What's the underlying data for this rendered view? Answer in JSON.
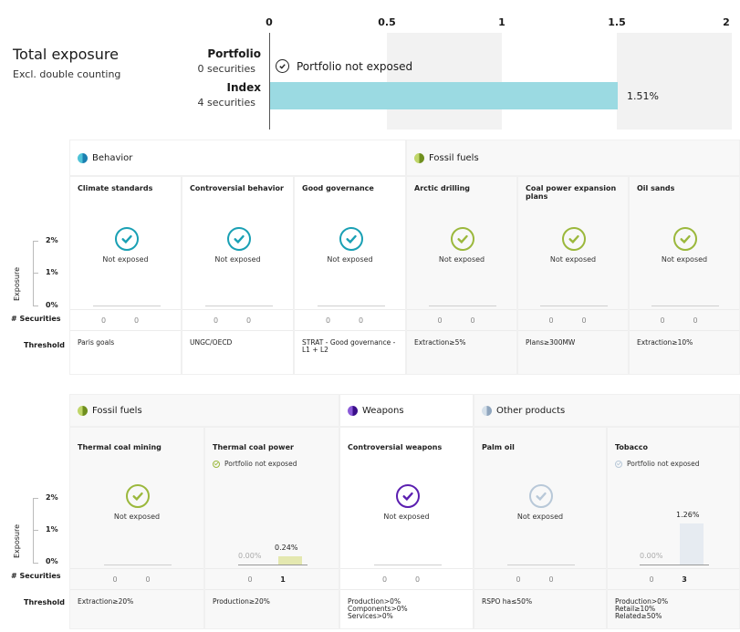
{
  "total": {
    "title": "Total exposure",
    "subtitle": "Excl. double counting",
    "axis_ticks": [
      "0",
      "0.5",
      "1",
      "1.5",
      "2"
    ],
    "portfolio": {
      "label": "Portfolio",
      "count": "0 securities",
      "status": "Portfolio not exposed",
      "value": 0
    },
    "index": {
      "label": "Index",
      "count": "4 securities",
      "value": 1.51,
      "value_label": "1.51%"
    },
    "bar_color": "#9bdae2"
  },
  "y_axis": {
    "label": "Exposure",
    "ticks": [
      "2%",
      "1%",
      "0%"
    ]
  },
  "row_labels": {
    "securities": "# Securities",
    "threshold": "Threshold"
  },
  "not_exposed_text": "Not exposed",
  "portfolio_not_exposed_text": "Portfolio not exposed",
  "groups_row1": [
    {
      "name": "Behavior",
      "color": "#1aa0b4"
    },
    {
      "name": "Fossil fuels",
      "color": "#9bb83c"
    }
  ],
  "groups_row2": [
    {
      "name": "Fossil fuels",
      "color": "#9bb83c"
    },
    {
      "name": "Weapons",
      "color": "#5b1fb0"
    },
    {
      "name": "Other products",
      "color": "#b8c8d8"
    }
  ],
  "categories_row1": [
    {
      "title": "Climate standards",
      "counts": [
        "0",
        "0"
      ],
      "threshold": [
        "Paris goals"
      ]
    },
    {
      "title": "Controversial behavior",
      "counts": [
        "0",
        "0"
      ],
      "threshold": [
        "UNGC/OECD"
      ]
    },
    {
      "title": "Good governance",
      "counts": [
        "0",
        "0"
      ],
      "threshold": [
        "STRAT - Good governance -",
        "L1 + L2"
      ]
    },
    {
      "title": "Arctic drilling",
      "counts": [
        "0",
        "0"
      ],
      "threshold": [
        "Extraction≥5%"
      ]
    },
    {
      "title": "Coal power expansion plans",
      "counts": [
        "0",
        "0"
      ],
      "threshold": [
        "Plans≥300MW"
      ]
    },
    {
      "title": "Oil sands",
      "counts": [
        "0",
        "0"
      ],
      "threshold": [
        "Extraction≥10%"
      ]
    }
  ],
  "categories_row2": [
    {
      "title": "Thermal coal mining",
      "counts": [
        "0",
        "0"
      ],
      "threshold": [
        "Extraction≥20%"
      ]
    },
    {
      "title": "Thermal coal power",
      "counts": [
        "0",
        "1"
      ],
      "threshold": [
        "Production≥20%"
      ],
      "portfolio_pct": "0.00%",
      "index_pct": "0.24%",
      "index_value": 0.24
    },
    {
      "title": "Controversial weapons",
      "counts": [
        "0",
        "0"
      ],
      "threshold": [
        "Production>0%",
        "Components>0%",
        "Services>0%"
      ]
    },
    {
      "title": "Palm oil",
      "counts": [
        "0",
        "0"
      ],
      "threshold": [
        "RSPO ha≤50%"
      ]
    },
    {
      "title": "Tobacco",
      "counts": [
        "0",
        "3"
      ],
      "threshold": [
        "Production>0%",
        "Retail≥10%",
        "Related≥50%"
      ],
      "portfolio_pct": "0.00%",
      "index_pct": "1.26%",
      "index_value": 1.26
    }
  ]
}
